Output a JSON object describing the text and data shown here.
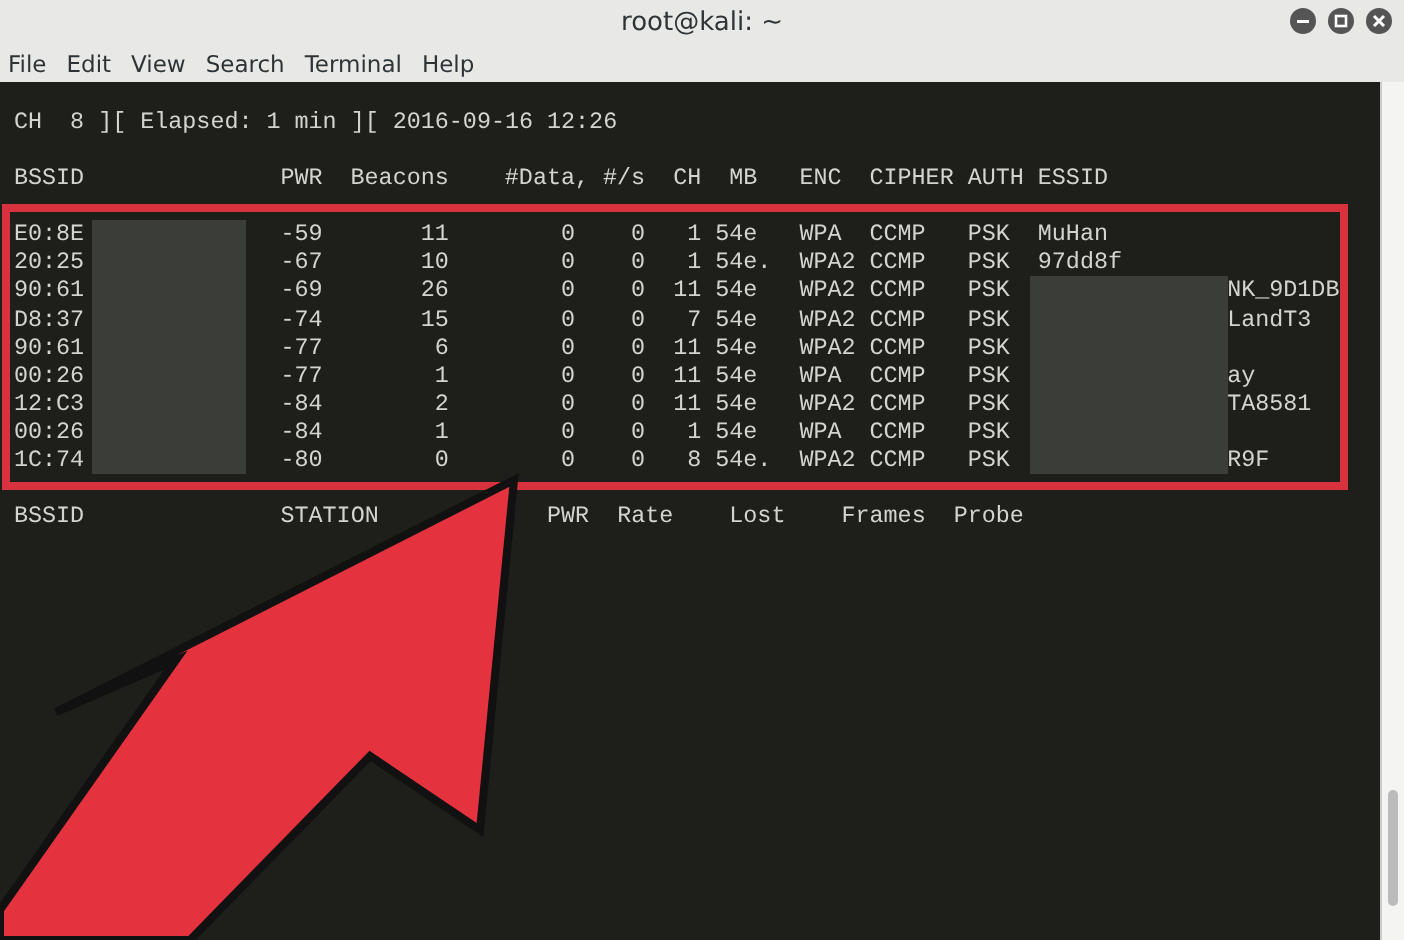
{
  "window": {
    "title": "root@kali: ~"
  },
  "menu": [
    "File",
    "Edit",
    "View",
    "Search",
    "Terminal",
    "Help"
  ],
  "status_line": "CH  8 ][ Elapsed: 1 min ][ 2016-09-16 12:26",
  "ap_table": {
    "columns": [
      "BSSID",
      "PWR",
      "Beacons",
      "#Data, #/s",
      "CH",
      "MB",
      "ENC",
      "CIPHER",
      "AUTH",
      "ESSID"
    ],
    "rows": [
      {
        "bssid": "E0:8E",
        "pwr": "-59",
        "beacons": "11",
        "data": "0",
        "per_sec": "0",
        "ch": "1",
        "mb": "54e",
        "enc": "WPA",
        "cipher": "CCMP",
        "auth": "PSK",
        "essid": "MuHan",
        "essid_redacted": false
      },
      {
        "bssid": "20:25",
        "pwr": "-67",
        "beacons": "10",
        "data": "0",
        "per_sec": "0",
        "ch": "1",
        "mb": "54e.",
        "enc": "WPA2",
        "cipher": "CCMP",
        "auth": "PSK",
        "essid": "97dd8f",
        "essid_redacted": false
      },
      {
        "bssid": "90:61",
        "pwr": "-69",
        "beacons": "26",
        "data": "0",
        "per_sec": "0",
        "ch": "11",
        "mb": "54e",
        "enc": "WPA2",
        "cipher": "CCMP",
        "auth": "PSK",
        "essid": "NK_9D1DB",
        "essid_redacted": true
      },
      {
        "bssid": "D8:37",
        "pwr": "-74",
        "beacons": "15",
        "data": "0",
        "per_sec": "0",
        "ch": "7",
        "mb": "54e",
        "enc": "WPA2",
        "cipher": "CCMP",
        "auth": "PSK",
        "essid": "LandT3",
        "essid_redacted": true
      },
      {
        "bssid": "90:61",
        "pwr": "-77",
        "beacons": "6",
        "data": "0",
        "per_sec": "0",
        "ch": "11",
        "mb": "54e",
        "enc": "WPA2",
        "cipher": "CCMP",
        "auth": "PSK",
        "essid_redacted": true
      },
      {
        "bssid": "00:26",
        "pwr": "-77",
        "beacons": "1",
        "data": "0",
        "per_sec": "0",
        "ch": "11",
        "mb": "54e",
        "enc": "WPA",
        "cipher": "CCMP",
        "auth": "PSK",
        "essid": "ay",
        "essid_redacted": true
      },
      {
        "bssid": "12:C3",
        "pwr": "-84",
        "beacons": "2",
        "data": "0",
        "per_sec": "0",
        "ch": "11",
        "mb": "54e",
        "enc": "WPA2",
        "cipher": "CCMP",
        "auth": "PSK",
        "essid": "TA8581",
        "essid_redacted": true
      },
      {
        "bssid": "00:26",
        "pwr": "-84",
        "beacons": "1",
        "data": "0",
        "per_sec": "0",
        "ch": "1",
        "mb": "54e",
        "enc": "WPA",
        "cipher": "CCMP",
        "auth": "PSK",
        "essid_redacted": true
      },
      {
        "bssid": "1C:74",
        "pwr": "-80",
        "beacons": "0",
        "data": "0",
        "per_sec": "0",
        "ch": "8",
        "mb": "54e.",
        "enc": "WPA2",
        "cipher": "CCMP",
        "auth": "PSK",
        "essid": "R9F",
        "essid_redacted": true
      }
    ]
  },
  "station_table": {
    "columns": [
      "BSSID",
      "STATION",
      "PWR",
      "Rate",
      "Lost",
      "Frames",
      "Probe"
    ]
  }
}
